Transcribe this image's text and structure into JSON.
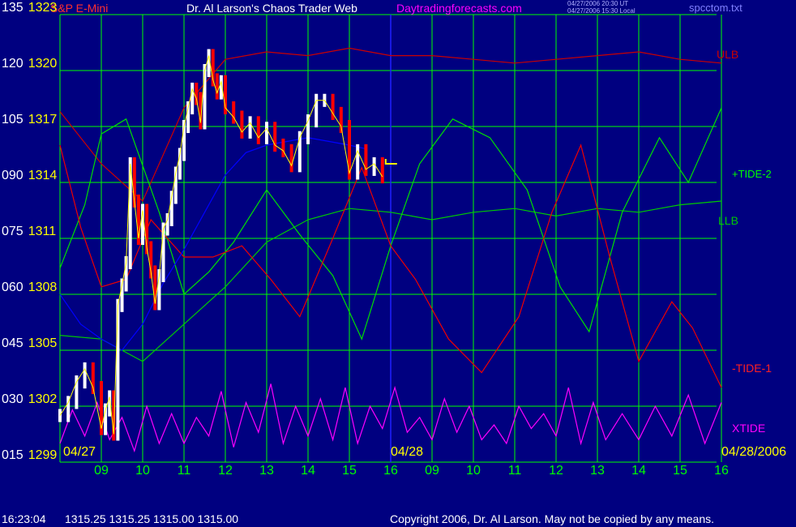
{
  "header": {
    "instrument": "S&P E-Mini",
    "title": "Dr. Al Larson's Chaos Trader Web",
    "site": "Daytradingforecasts.com",
    "ut_time": "04/27/2006 20:30 UT",
    "local_time": "04/27/2006 15:30 Local",
    "file": "spcctom.txt"
  },
  "footer": {
    "time": "16:23:04",
    "ohlc": "1315.25 1315.25 1315.00 1315.00",
    "copyright": "Copyright 2006, Dr. Al Larson. May not be copied by any means."
  },
  "colors": {
    "background": "#000080",
    "grid": "#00ff00",
    "price_up": "#ffffff",
    "price_down": "#ff0000",
    "ulb": "#cc0000",
    "llb": "#00cc00",
    "tide_plus": "#00e000",
    "tide_minus": "#ee0000",
    "xtide": "#ff00ff",
    "average": "#0000ff"
  },
  "chart_data": {
    "type": "line",
    "title": "Dr. Al Larson's Chaos Trader Web",
    "y_left_labels": [
      {
        "osc": "135",
        "price": "1323"
      },
      {
        "osc": "120",
        "price": "1320"
      },
      {
        "osc": "105",
        "price": "1317"
      },
      {
        "osc": "090",
        "price": "1314"
      },
      {
        "osc": "075",
        "price": "1311"
      },
      {
        "osc": "060",
        "price": "1308"
      },
      {
        "osc": "045",
        "price": "1305"
      },
      {
        "osc": "030",
        "price": "1302"
      },
      {
        "osc": "015",
        "price": "1299"
      }
    ],
    "price_range": [
      1299,
      1323
    ],
    "oscillator_range": [
      15,
      135
    ],
    "x_ticks": [
      "09",
      "10",
      "11",
      "12",
      "13",
      "14",
      "15",
      "16",
      "09",
      "10",
      "11",
      "12",
      "13",
      "14",
      "15",
      "16"
    ],
    "date_labels": [
      "04/27",
      "04/28",
      "04/28/2006"
    ],
    "series_labels": {
      "ulb": "ULB",
      "tide_plus": "+TIDE-2",
      "llb": "LLB",
      "tide_minus": "-TIDE-1",
      "xtide": "XTIDE"
    },
    "grid": true,
    "price_series": {
      "name": "S&P E-Mini",
      "x": [
        0,
        0.2,
        0.4,
        0.6,
        0.8,
        1.0,
        1.1,
        1.2,
        1.3,
        1.4,
        1.5,
        1.6,
        1.7,
        1.8,
        1.9,
        2.0,
        2.1,
        2.2,
        2.3,
        2.4,
        2.5,
        2.6,
        2.7,
        2.8,
        2.9,
        3.0,
        3.1,
        3.2,
        3.3,
        3.4,
        3.5,
        3.6,
        3.7,
        3.8,
        3.9,
        4.0,
        4.2,
        4.4,
        4.6,
        4.8,
        5.0,
        5.2,
        5.4,
        5.6,
        5.8,
        6.0,
        6.2,
        6.4,
        6.6,
        6.8,
        7.0,
        7.2,
        7.4,
        7.6,
        7.8
      ],
      "values": [
        1301.5,
        1302.2,
        1303.3,
        1304.0,
        1303.0,
        1300.8,
        1301.8,
        1302.5,
        1300.5,
        1307.4,
        1308.5,
        1309.7,
        1315.0,
        1313.0,
        1311.0,
        1312.5,
        1310.5,
        1309.2,
        1307.5,
        1309.0,
        1311.5,
        1312.0,
        1313.2,
        1314.5,
        1315.5,
        1317.0,
        1318.0,
        1319.0,
        1318.5,
        1317.2,
        1320.0,
        1320.8,
        1319.5,
        1318.8,
        1319.4,
        1318.0,
        1317.5,
        1316.7,
        1317.2,
        1316.4,
        1316.9,
        1316.0,
        1315.7,
        1314.9,
        1316.4,
        1317.3,
        1318.4,
        1318.4,
        1317.7,
        1317.0,
        1314.5,
        1315.7,
        1314.7,
        1315.0,
        1314.3
      ],
      "last": 1315.0
    },
    "lines": [
      {
        "id": "ulb",
        "x": [
          0,
          1,
          2,
          3,
          4,
          5,
          6,
          7,
          8,
          9,
          10,
          11,
          12,
          13,
          14,
          15,
          16
        ],
        "y": [
          109,
          95,
          85,
          110,
          123,
          125,
          124,
          126,
          124,
          124,
          123,
          122,
          123,
          124,
          125,
          123,
          122
        ]
      },
      {
        "id": "llb",
        "x": [
          0,
          1,
          2,
          3,
          4,
          5,
          6,
          7,
          8,
          9,
          10,
          11,
          12,
          13,
          14,
          15,
          16
        ],
        "y": [
          49,
          48,
          42,
          52,
          62,
          74,
          80,
          83,
          82,
          80,
          82,
          83,
          81,
          83,
          82,
          84,
          85
        ]
      },
      {
        "id": "tide_plus",
        "x": [
          0,
          0.6,
          1,
          1.6,
          2.4,
          3,
          3.6,
          4.2,
          5,
          5.8,
          6.6,
          7.3,
          8,
          8.7,
          9.5,
          10.4,
          11.3,
          12.1,
          12.8,
          13.6,
          14.5,
          15.2,
          16
        ],
        "y": [
          67,
          84,
          103,
          107,
          82,
          60,
          66,
          74,
          88,
          76,
          65,
          48,
          73,
          95,
          107,
          102,
          88,
          62,
          50,
          82,
          102,
          90,
          110
        ]
      },
      {
        "id": "tide_minus",
        "x": [
          0,
          0.5,
          1,
          1.6,
          2.2,
          3,
          3.7,
          4.4,
          5.1,
          5.8,
          6.6,
          7.3,
          8,
          8.6,
          9.4,
          10.2,
          11.1,
          11.9,
          12.6,
          13.3,
          14,
          14.8,
          15.3,
          16
        ],
        "y": [
          100,
          78,
          62,
          64,
          80,
          70,
          70,
          73,
          64,
          54,
          75,
          94,
          73,
          64,
          48,
          39,
          54,
          82,
          100,
          70,
          42,
          58,
          51,
          35
        ]
      },
      {
        "id": "xtide",
        "x": [
          0,
          0.3,
          0.6,
          0.9,
          1.2,
          1.5,
          1.8,
          2.1,
          2.4,
          2.7,
          3.0,
          3.3,
          3.6,
          3.9,
          4.2,
          4.5,
          4.8,
          5.1,
          5.4,
          5.7,
          6.0,
          6.3,
          6.6,
          6.9,
          7.2,
          7.5,
          7.8,
          8.1,
          8.4,
          8.7,
          9.0,
          9.3,
          9.6,
          9.9,
          10.2,
          10.5,
          10.8,
          11.1,
          11.4,
          11.7,
          12.0,
          12.3,
          12.6,
          12.9,
          13.2,
          13.6,
          14.0,
          14.4,
          14.8,
          15.2,
          15.6,
          16
        ],
        "y": [
          20,
          29,
          22,
          31,
          21,
          27,
          18,
          30,
          20,
          28,
          20,
          27,
          22,
          34,
          19,
          31,
          23,
          36,
          20,
          30,
          22,
          32,
          21,
          35,
          20,
          30,
          24,
          35,
          23,
          27,
          21,
          32,
          23,
          30,
          21,
          25,
          20,
          30,
          24,
          28,
          22,
          35,
          20,
          31,
          21,
          28,
          21,
          30,
          22,
          33,
          20,
          31
        ]
      },
      {
        "id": "average",
        "x": [
          0,
          0.5,
          1,
          1.5,
          2,
          2.5,
          3,
          3.5,
          4,
          4.5,
          5,
          5.5,
          6,
          6.5,
          7,
          7.4
        ],
        "y": [
          60,
          52,
          48,
          45,
          52,
          63,
          72,
          82,
          92,
          98,
          100,
          101,
          102,
          101,
          100,
          99
        ]
      }
    ]
  }
}
